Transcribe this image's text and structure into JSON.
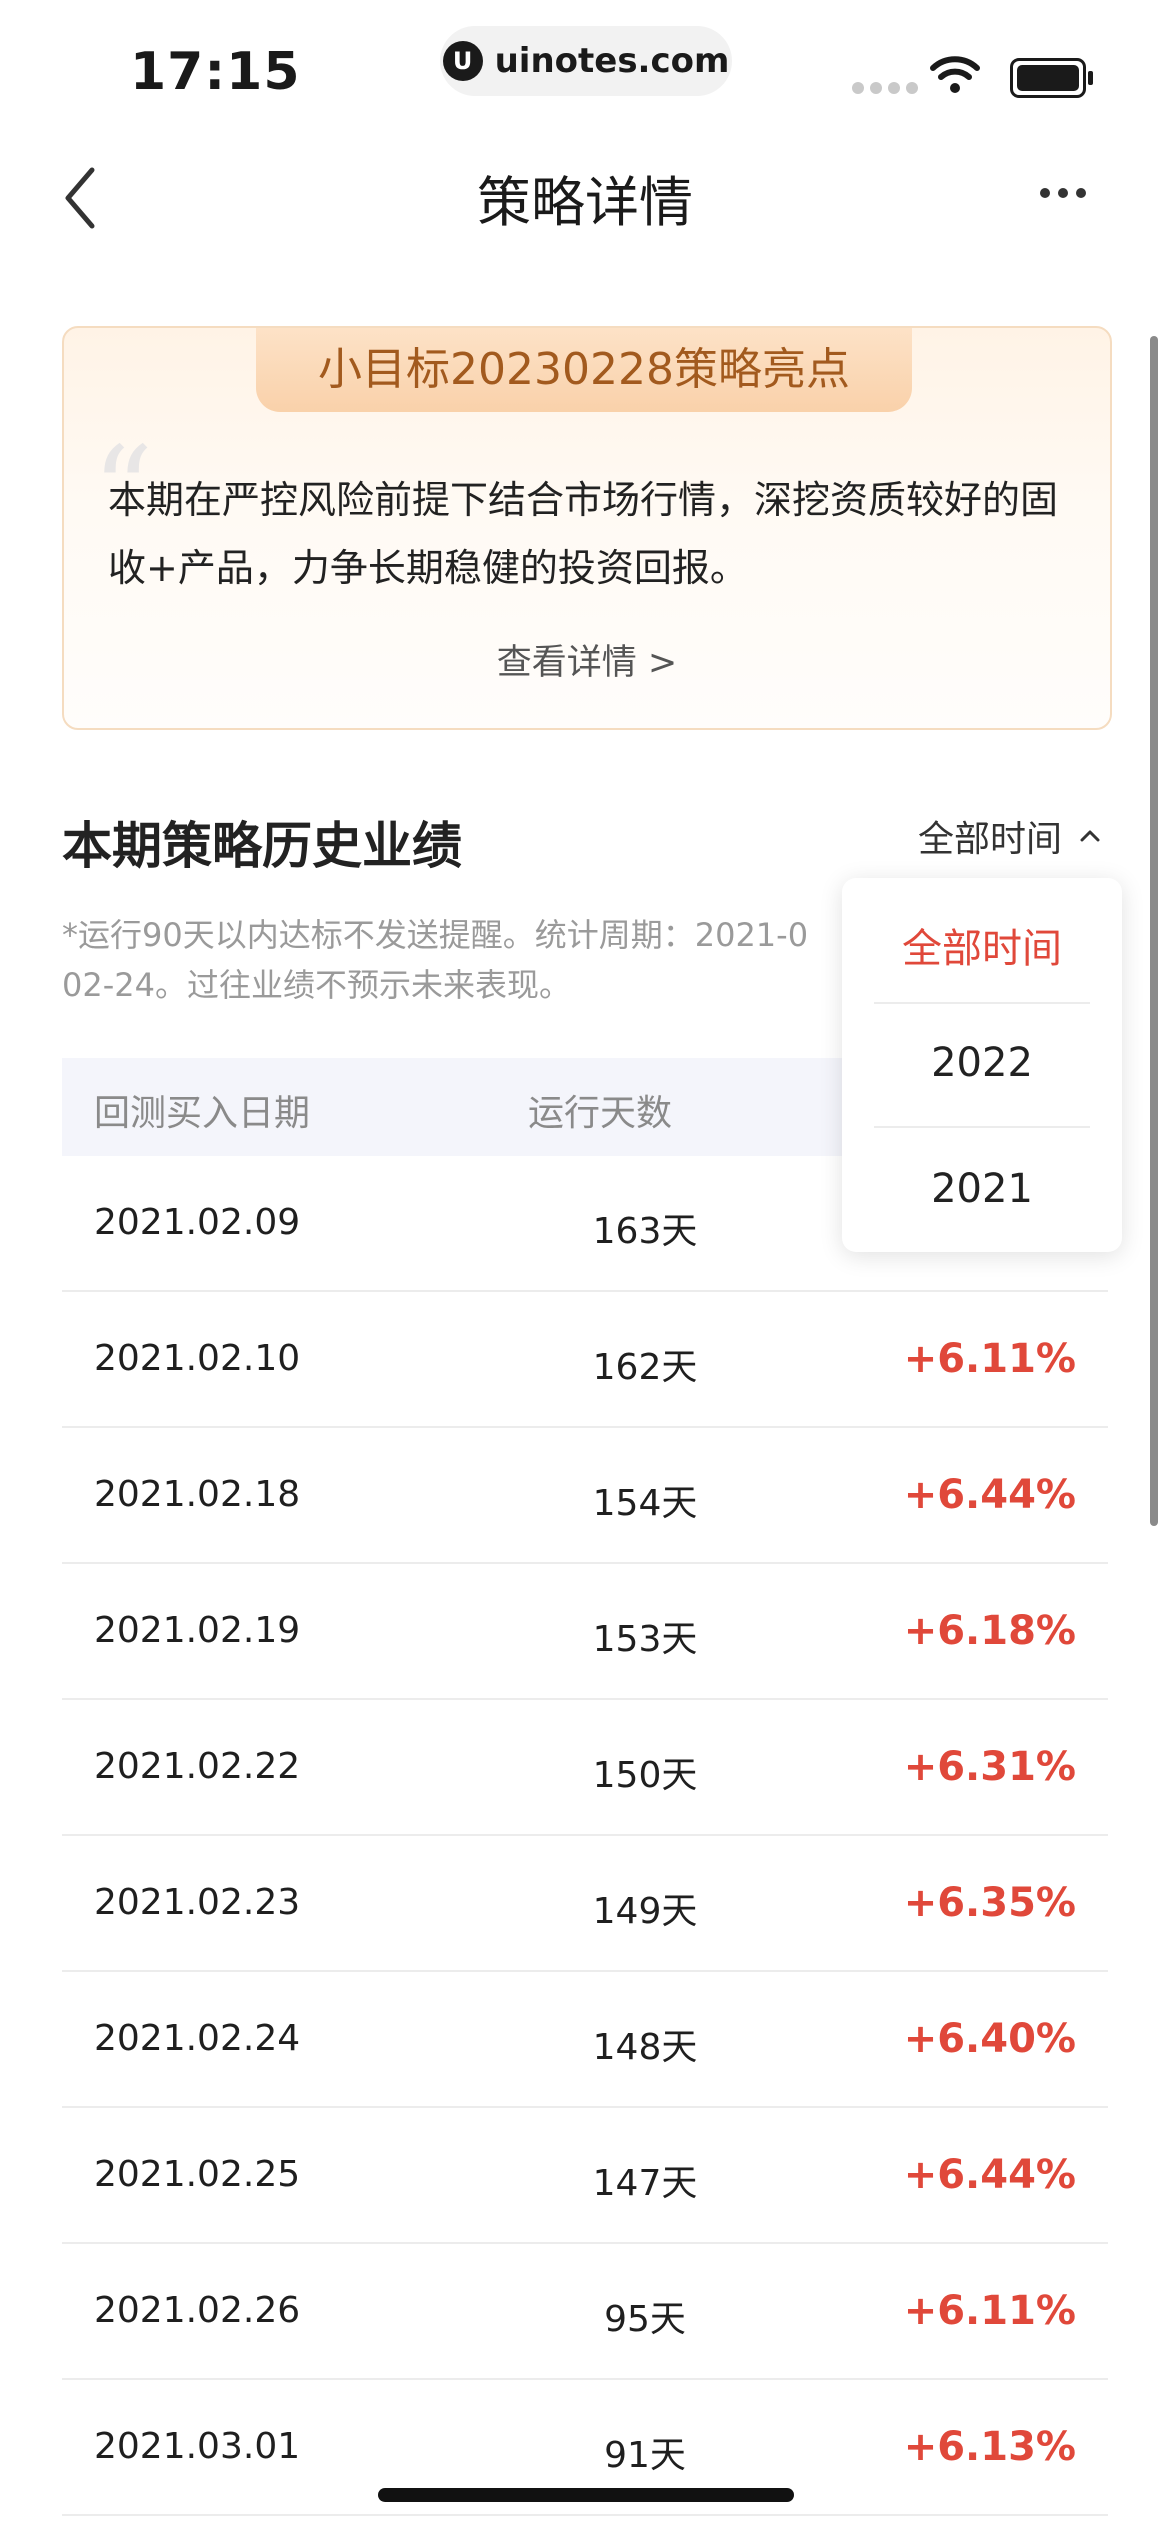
{
  "status_bar": {
    "time": "17:15",
    "url": "uinotes.com",
    "url_icon": "U"
  },
  "nav": {
    "title": "策略详情"
  },
  "highlight": {
    "badge": "小目标20230228策略亮点",
    "text": "本期在严控风险前提下结合市场行情，深挖资质较好的固收+产品，力争长期稳健的投资回报。",
    "link": "查看详情 >"
  },
  "history": {
    "title": "本期策略历史业绩",
    "filter_label": "全部时间",
    "note_line1": "*运行90天以内达标不发送提醒。统计周期：2021-0",
    "note_line2": "02-24。过往业绩不预示未来表现。"
  },
  "table": {
    "headers": [
      "回测买入日期",
      "运行天数"
    ],
    "rows": [
      {
        "date": "2021.02.09",
        "days": "163天",
        "ret": ""
      },
      {
        "date": "2021.02.10",
        "days": "162天",
        "ret": "+6.11%"
      },
      {
        "date": "2021.02.18",
        "days": "154天",
        "ret": "+6.44%"
      },
      {
        "date": "2021.02.19",
        "days": "153天",
        "ret": "+6.18%"
      },
      {
        "date": "2021.02.22",
        "days": "150天",
        "ret": "+6.31%"
      },
      {
        "date": "2021.02.23",
        "days": "149天",
        "ret": "+6.35%"
      },
      {
        "date": "2021.02.24",
        "days": "148天",
        "ret": "+6.40%"
      },
      {
        "date": "2021.02.25",
        "days": "147天",
        "ret": "+6.44%"
      },
      {
        "date": "2021.02.26",
        "days": "95天",
        "ret": "+6.11%"
      },
      {
        "date": "2021.03.01",
        "days": "91天",
        "ret": "+6.13%"
      }
    ]
  },
  "dropdown": {
    "options": [
      "全部时间",
      "2022",
      "2021"
    ],
    "selected": "全部时间"
  },
  "colors": {
    "accent_red": "#e0483a",
    "badge_text": "#a25a1e"
  }
}
